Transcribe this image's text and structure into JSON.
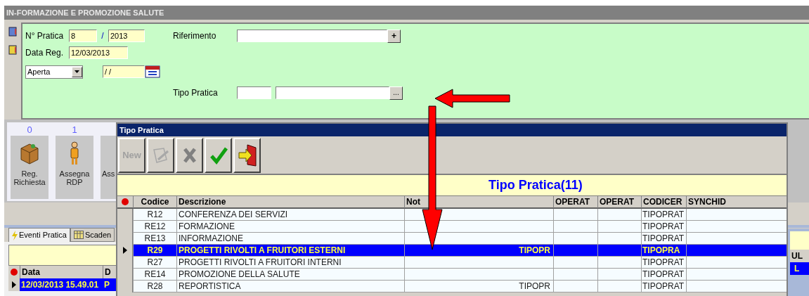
{
  "window": {
    "title": "IN-FORMAZIONE E PROMOZIONE SALUTE"
  },
  "form": {
    "numero_label": "N° Pratica",
    "numero": "8",
    "separator": "/",
    "anno": "2013",
    "data_reg_label": "Data Reg.",
    "data_reg": "12/03/2013",
    "stato": "Aperta",
    "data": "/ /",
    "riferimento_label": "Riferimento",
    "riferimento_button": "+",
    "tipo_label": "Tipo Pratica",
    "tipo_button": "..."
  },
  "counters": [
    {
      "count": "0",
      "label": "Reg. Richiesta",
      "kind": "package"
    },
    {
      "count": "1",
      "label": "Assegna RDP",
      "kind": "person"
    },
    {
      "label": "Ass",
      "kind": "other"
    }
  ],
  "bottom_tabs": [
    {
      "label": "Eventi Pratica",
      "selected": true,
      "kind": "events"
    },
    {
      "label": "Scaden",
      "selected": false,
      "kind": "calendar"
    }
  ],
  "events_grid": {
    "columns": [
      "Data",
      "D"
    ],
    "rows": [
      {
        "cells": [
          "12/03/2013 15.49.01",
          "P"
        ],
        "selected": true
      }
    ]
  },
  "right_grid": {
    "column": "UL",
    "cell": "L"
  },
  "dialog": {
    "title": "Tipo Pratica",
    "caption": "Tipo Pratica(11)",
    "toolbar": [
      {
        "kind": "new",
        "label": "New",
        "disabled": true
      },
      {
        "kind": "edit",
        "disabled": true
      },
      {
        "kind": "delete",
        "disabled": true
      },
      {
        "kind": "confirm",
        "disabled": false
      },
      {
        "kind": "exit",
        "disabled": false
      }
    ],
    "columns": [
      "Codice",
      "Descrizione",
      "Not",
      "OPERAT",
      "OPERAT",
      "CODICER",
      "SYNCHID"
    ],
    "rows": [
      {
        "codice": "R12",
        "descrizione": "CONFERENZA DEI SERVIZI",
        "codicer": "TIPOPRAT",
        "selected": false
      },
      {
        "codice": "RE12",
        "descrizione": "FORMAZIONE",
        "codicer": "TIPOPRAT",
        "selected": false
      },
      {
        "codice": "RE13",
        "descrizione": "INFORMAZIONE",
        "codicer": "TIPOPRAT",
        "selected": false
      },
      {
        "codice": "R29",
        "descrizione": "PROGETTI RIVOLTI A FRUITORI ESTERNI",
        "note": "TIPOPR",
        "codicer": "TIPOPRA",
        "selected": true
      },
      {
        "codice": "R27",
        "descrizione": "PROGETTI RIVOLTI A FRUITORI INTERNI",
        "codicer": "TIPOPRAT",
        "selected": false
      },
      {
        "codice": "RE14",
        "descrizione": "PROMOZIONE DELLA SALUTE",
        "codicer": "TIPOPRAT",
        "selected": false
      },
      {
        "codice": "R28",
        "descrizione": "REPORTISTICA",
        "note": "TIPOPR",
        "codicer": "TIPOPRAT",
        "selected": false
      }
    ]
  }
}
